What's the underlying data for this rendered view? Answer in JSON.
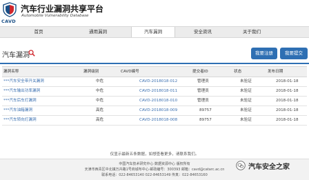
{
  "header": {
    "title": "汽车行业漏洞共享平台",
    "subtitle": "Automobile Vulnerability Database",
    "logo_text": "CAVD"
  },
  "nav": [
    "首页",
    "通用漏洞",
    "汽车漏洞",
    "安全资讯",
    "关于我们"
  ],
  "nav_active_index": 2,
  "page": {
    "title": "汽车漏洞",
    "register_button": "我要注册",
    "submit_button": "我要提交"
  },
  "table": {
    "headers": [
      "漏洞名称",
      "漏洞级别",
      "CAVD编号",
      "提交者ID",
      "状态",
      "发布日期"
    ],
    "rows": [
      {
        "name": "***汽车安全带开关漏洞",
        "level": "中危",
        "id": "CAVD-2018018-012",
        "submitter": "管理员",
        "status": "未验证",
        "date": "2018-01-18"
      },
      {
        "name": "***汽车输出功率漏洞",
        "level": "中危",
        "id": "CAVD-2018018-011",
        "submitter": "管理员",
        "status": "未验证",
        "date": "2018-01-18"
      },
      {
        "name": "***汽车后车灯漏洞",
        "level": "中危",
        "id": "CAVD-2018018-010",
        "submitter": "管理员",
        "status": "未验证",
        "date": "2018-01-18"
      },
      {
        "name": "***汽车油箱漏洞",
        "level": "高危",
        "id": "CAVD-2018018-009",
        "submitter": "89757",
        "status": "未验证",
        "date": "2018-01-18"
      },
      {
        "name": "***汽车转向灯漏洞",
        "level": "高危",
        "id": "CAVD-2018018-008",
        "submitter": "89757",
        "status": "未验证",
        "date": "2018-01-18"
      }
    ]
  },
  "note": "仅显示最新五条数据，如想查看更多，请联系我们。",
  "footer": {
    "line1": "中国汽车技术研究中心·数据资源中心 版权所有",
    "line2": "天津市西青区中北镇万卉路1号商城布中心·邮政编号：300393  邮箱：cavd@catarc.ac.cn",
    "line3": "联系电话：022-84653140 022-84653149 传真：022-84653160"
  },
  "watermark": "汽车安全之家",
  "colors": {
    "accent": "#2e6fb3",
    "link": "#3a6fb0",
    "brand": "#1a4f86",
    "logo_red": "#d0262c"
  }
}
